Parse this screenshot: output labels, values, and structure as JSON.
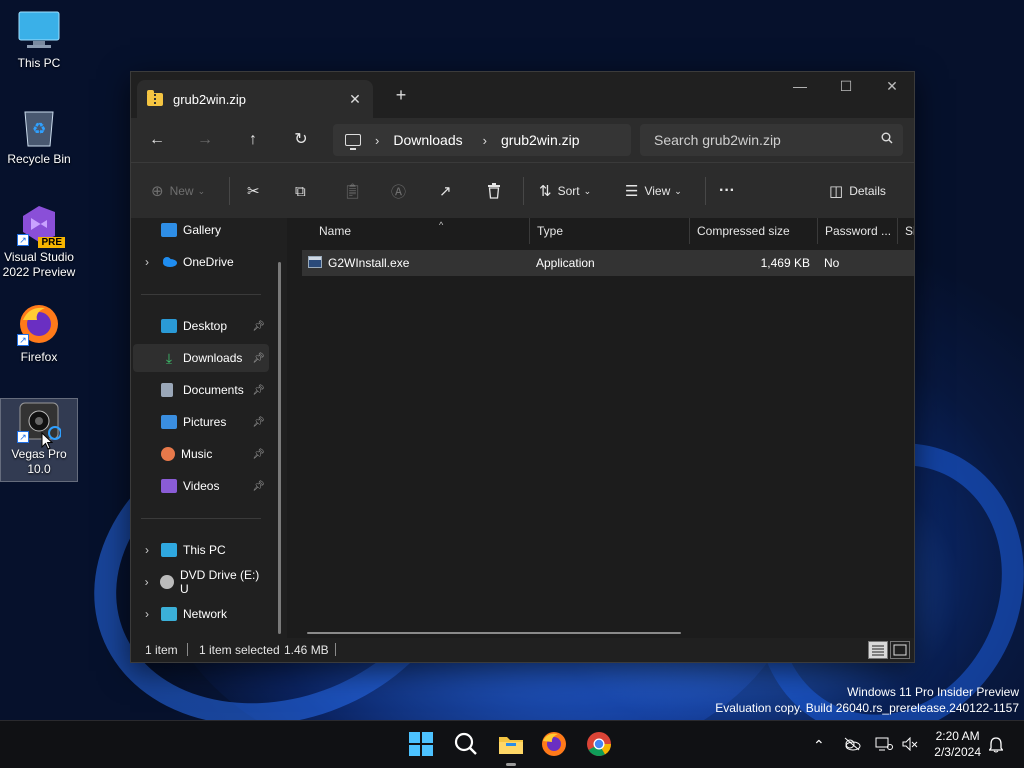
{
  "desktop": {
    "icons": [
      {
        "label": "This PC"
      },
      {
        "label": "Recycle Bin"
      },
      {
        "label": "Visual Studio 2022 Preview",
        "badge": "PRE"
      },
      {
        "label": "Firefox"
      },
      {
        "label": "Vegas Pro 10.0"
      }
    ]
  },
  "window": {
    "tab_title": "grub2win.zip",
    "tab_close": "✕",
    "new_tab": "+",
    "controls": {
      "minimize": "—",
      "maximize": "☐",
      "close": "✕"
    },
    "nav": {
      "back": "←",
      "forward": "→",
      "up": "↑",
      "refresh": "↻"
    },
    "breadcrumb": [
      "Downloads",
      "grub2win.zip"
    ],
    "breadcrumb_sep": "›",
    "search_placeholder": "Search grub2win.zip",
    "toolbar": {
      "new_label": "New",
      "sort_label": "Sort",
      "view_label": "View",
      "more_label": "···",
      "details_label": "Details"
    },
    "sidebar": {
      "top": [
        {
          "label": "Gallery"
        },
        {
          "label": "OneDrive"
        }
      ],
      "quick": [
        {
          "label": "Desktop"
        },
        {
          "label": "Downloads"
        },
        {
          "label": "Documents"
        },
        {
          "label": "Pictures"
        },
        {
          "label": "Music"
        },
        {
          "label": "Videos"
        }
      ],
      "devices": [
        {
          "label": "This PC"
        },
        {
          "label": "DVD Drive (E:) U"
        },
        {
          "label": "Network"
        }
      ]
    },
    "columns": [
      "Name",
      "Type",
      "Compressed size",
      "Password ...",
      "Si"
    ],
    "files": [
      {
        "name": "G2WInstall.exe",
        "type": "Application",
        "compressed_size": "1,469 KB",
        "password": "No"
      }
    ],
    "status": {
      "count": "1 item",
      "selected": "1 item selected",
      "size": "1.46 MB"
    }
  },
  "watermark": {
    "line1": "Windows 11 Pro Insider Preview",
    "line2": "Evaluation copy. Build 26040.rs_prerelease.240122-1157"
  },
  "taskbar": {
    "time": "2:20 AM",
    "date": "2/3/2024"
  },
  "colors": {
    "accent": "#0078d4",
    "window_bg": "#1c1c1c",
    "selected_row": "#333333"
  }
}
